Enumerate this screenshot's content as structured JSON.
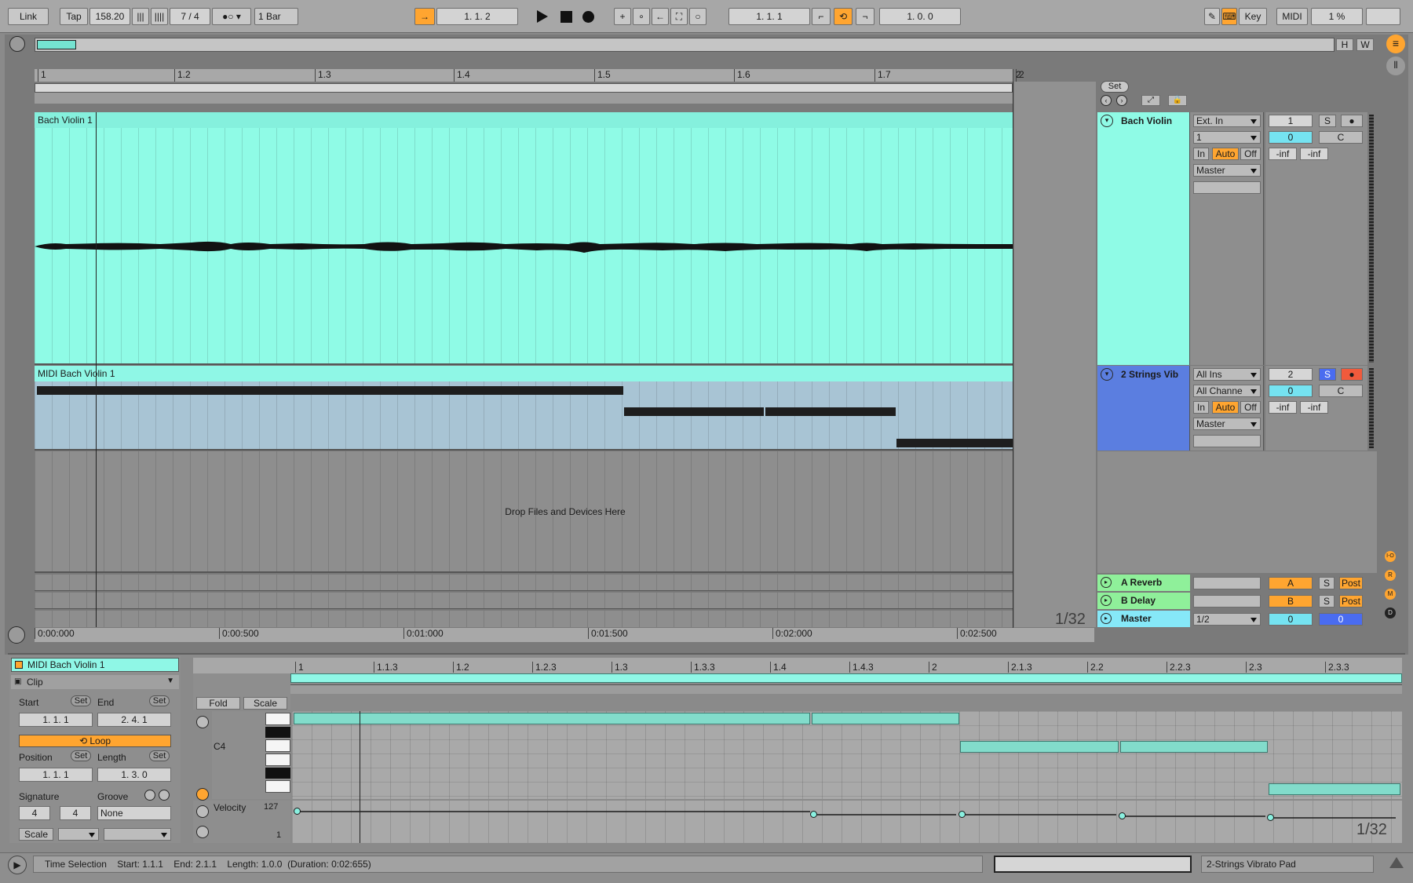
{
  "transport": {
    "link": "Link",
    "tap": "Tap",
    "tempo": "158.20",
    "signature": "7 / 4",
    "quantize": "1 Bar",
    "arrangement_position": "1.   1.   2",
    "loop_start": "1.   1.   1",
    "loop_length": "1.   0.   0",
    "key": "Key",
    "midi": "MIDI",
    "cpu": "1 %"
  },
  "overview": {
    "h": "H",
    "w": "W"
  },
  "arrangement_ruler": [
    "1",
    "1.2",
    "1.3",
    "1.4",
    "1.5",
    "1.6",
    "1.7",
    "2"
  ],
  "time_ruler": [
    "0:00:000",
    "0:00:500",
    "0:01:000",
    "0:01:500",
    "0:02:000",
    "0:02:500"
  ],
  "set_label": "Set",
  "tracks": [
    {
      "clip_name": "Bach Violin 1",
      "name": "Bach Violin",
      "input_type": "Ext. In",
      "input_channel": "1",
      "monitor": [
        "In",
        "Auto",
        "Off"
      ],
      "output": "Master",
      "track_number": "1",
      "solo": "S",
      "volume": "0",
      "pan": "C",
      "meter_left": "-inf",
      "meter_right": "-inf"
    },
    {
      "clip_name": "MIDI Bach Violin 1",
      "name": "2 Strings Vib",
      "input_type": "All Ins",
      "input_channel": "All Channe",
      "monitor": [
        "In",
        "Auto",
        "Off"
      ],
      "output": "Master",
      "track_number": "2",
      "solo": "S",
      "volume": "0",
      "pan": "C",
      "meter_left": "-inf",
      "meter_right": "-inf"
    }
  ],
  "drop_hint": "Drop Files and Devices Here",
  "returns": [
    {
      "name": "A Reverb",
      "send": "A",
      "solo": "S",
      "post": "Post"
    },
    {
      "name": "B Delay",
      "send": "B",
      "solo": "S",
      "post": "Post"
    }
  ],
  "master": {
    "name": "Master",
    "cue": "1/2",
    "volume": "0",
    "pan": "0"
  },
  "grid_label": "1/32",
  "side_letters": [
    "I-O",
    "R",
    "M",
    "D"
  ],
  "clip_view": {
    "clip_title": "MIDI Bach Violin 1",
    "section": "Clip",
    "start_label": "Start",
    "end_label": "End",
    "set": "Set",
    "start_value": "1.   1.   1",
    "end_value": "2.   4.   1",
    "loop": "Loop",
    "position_label": "Position",
    "length_label": "Length",
    "position_value": "1.   1.   1",
    "length_value": "1.   3.   0",
    "signature_label": "Signature",
    "groove_label": "Groove",
    "sig_num": "4",
    "sig_den": "4",
    "groove_value": "None",
    "scale": "Scale"
  },
  "midi_editor": {
    "ruler": [
      "1",
      "1.1.3",
      "1.2",
      "1.2.3",
      "1.3",
      "1.3.3",
      "1.4",
      "1.4.3",
      "2",
      "2.1.3",
      "2.2",
      "2.2.3",
      "2.3",
      "2.3.3"
    ],
    "fold": "Fold",
    "scale": "Scale",
    "key_label": "C4",
    "velocity_label": "Velocity",
    "vel_max": "127",
    "vel_min": "1",
    "grid_label": "1/32"
  },
  "status": {
    "text": "Time Selection    Start: 1.1.1    End: 2.1.1    Length: 1.0.0  (Duration: 0:02:655)",
    "device": "2-Strings Vibrato Pad"
  },
  "colors": {
    "audio_clip": "#8ffbe6",
    "midi_clip": "#a8c4d4",
    "accent_orange": "#ffa530",
    "track2_header": "#5b7ee0",
    "return_green": "#8ff09a",
    "master_cyan": "#86e8f8"
  }
}
